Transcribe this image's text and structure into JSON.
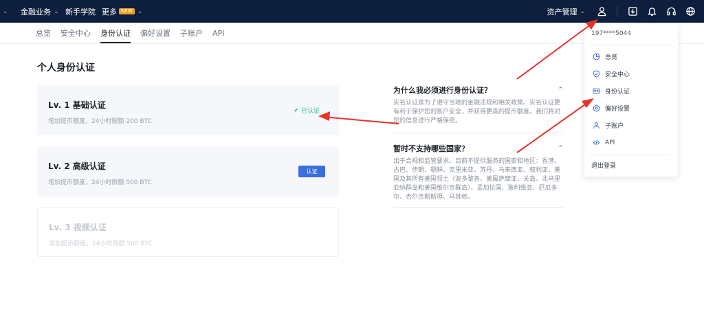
{
  "topbar": {
    "nav": [
      {
        "label": "金融业务"
      },
      {
        "label": "新手学院"
      },
      {
        "label": "更多",
        "badge": "NEW"
      }
    ],
    "asset_label": "资产管理"
  },
  "subnav": {
    "tabs": [
      {
        "label": "总览"
      },
      {
        "label": "安全中心"
      },
      {
        "label": "身份认证",
        "active": true
      },
      {
        "label": "偏好设置"
      },
      {
        "label": "子账户"
      },
      {
        "label": "API"
      }
    ]
  },
  "page": {
    "title": "个人身份认证"
  },
  "cards": [
    {
      "level": "Lv. 1 基础认证",
      "desc": "增加提币额度，24小时限额 200 BTC",
      "status": "已认证"
    },
    {
      "level": "Lv. 2 高级认证",
      "desc": "增加提币额度，24小时限额 500 BTC",
      "button": "认证"
    },
    {
      "level": "Lv. 3 视频认证",
      "desc": "增加提币额度，24小时限额 500 BTC"
    }
  ],
  "faq": [
    {
      "question": "为什么我必须进行身份认证？",
      "answer": "实名认证是为了遵守当地的金融法规和相关政策。实名认证更有利于保护您的账户安全，并获得更高的提币额度。我们将对您的信息进行严格保密。"
    },
    {
      "question": "暂时不支持哪些国家？",
      "answer": "出于合规和监管要求，目前不提供服务的国家和地区：香港、古巴、伊朗、朝鲜、克里米亚、苏丹、马来西亚、叙利亚、美国及其所有美国领土（波多黎各、美属萨摩亚、关岛、北马里亚纳群岛和美国维尔京群岛）、孟加拉国、玻利维亚、厄瓜多尔、吉尔吉斯斯坦、马耳他。"
    }
  ],
  "dropdown": {
    "account": "197****5044",
    "items": [
      {
        "label": "总览",
        "icon": "pie-icon"
      },
      {
        "label": "安全中心",
        "icon": "shield-icon"
      },
      {
        "label": "身份认证",
        "icon": "id-card-icon"
      },
      {
        "label": "偏好设置",
        "icon": "settings-icon"
      },
      {
        "label": "子账户",
        "icon": "user-icon"
      },
      {
        "label": "API",
        "icon": "code-icon"
      }
    ],
    "logout": "退出登录"
  },
  "colors": {
    "topbar_bg": "#0d1f3d",
    "primary": "#3a6fe0",
    "success": "#2dbd85",
    "annotation": "#e8322a"
  }
}
